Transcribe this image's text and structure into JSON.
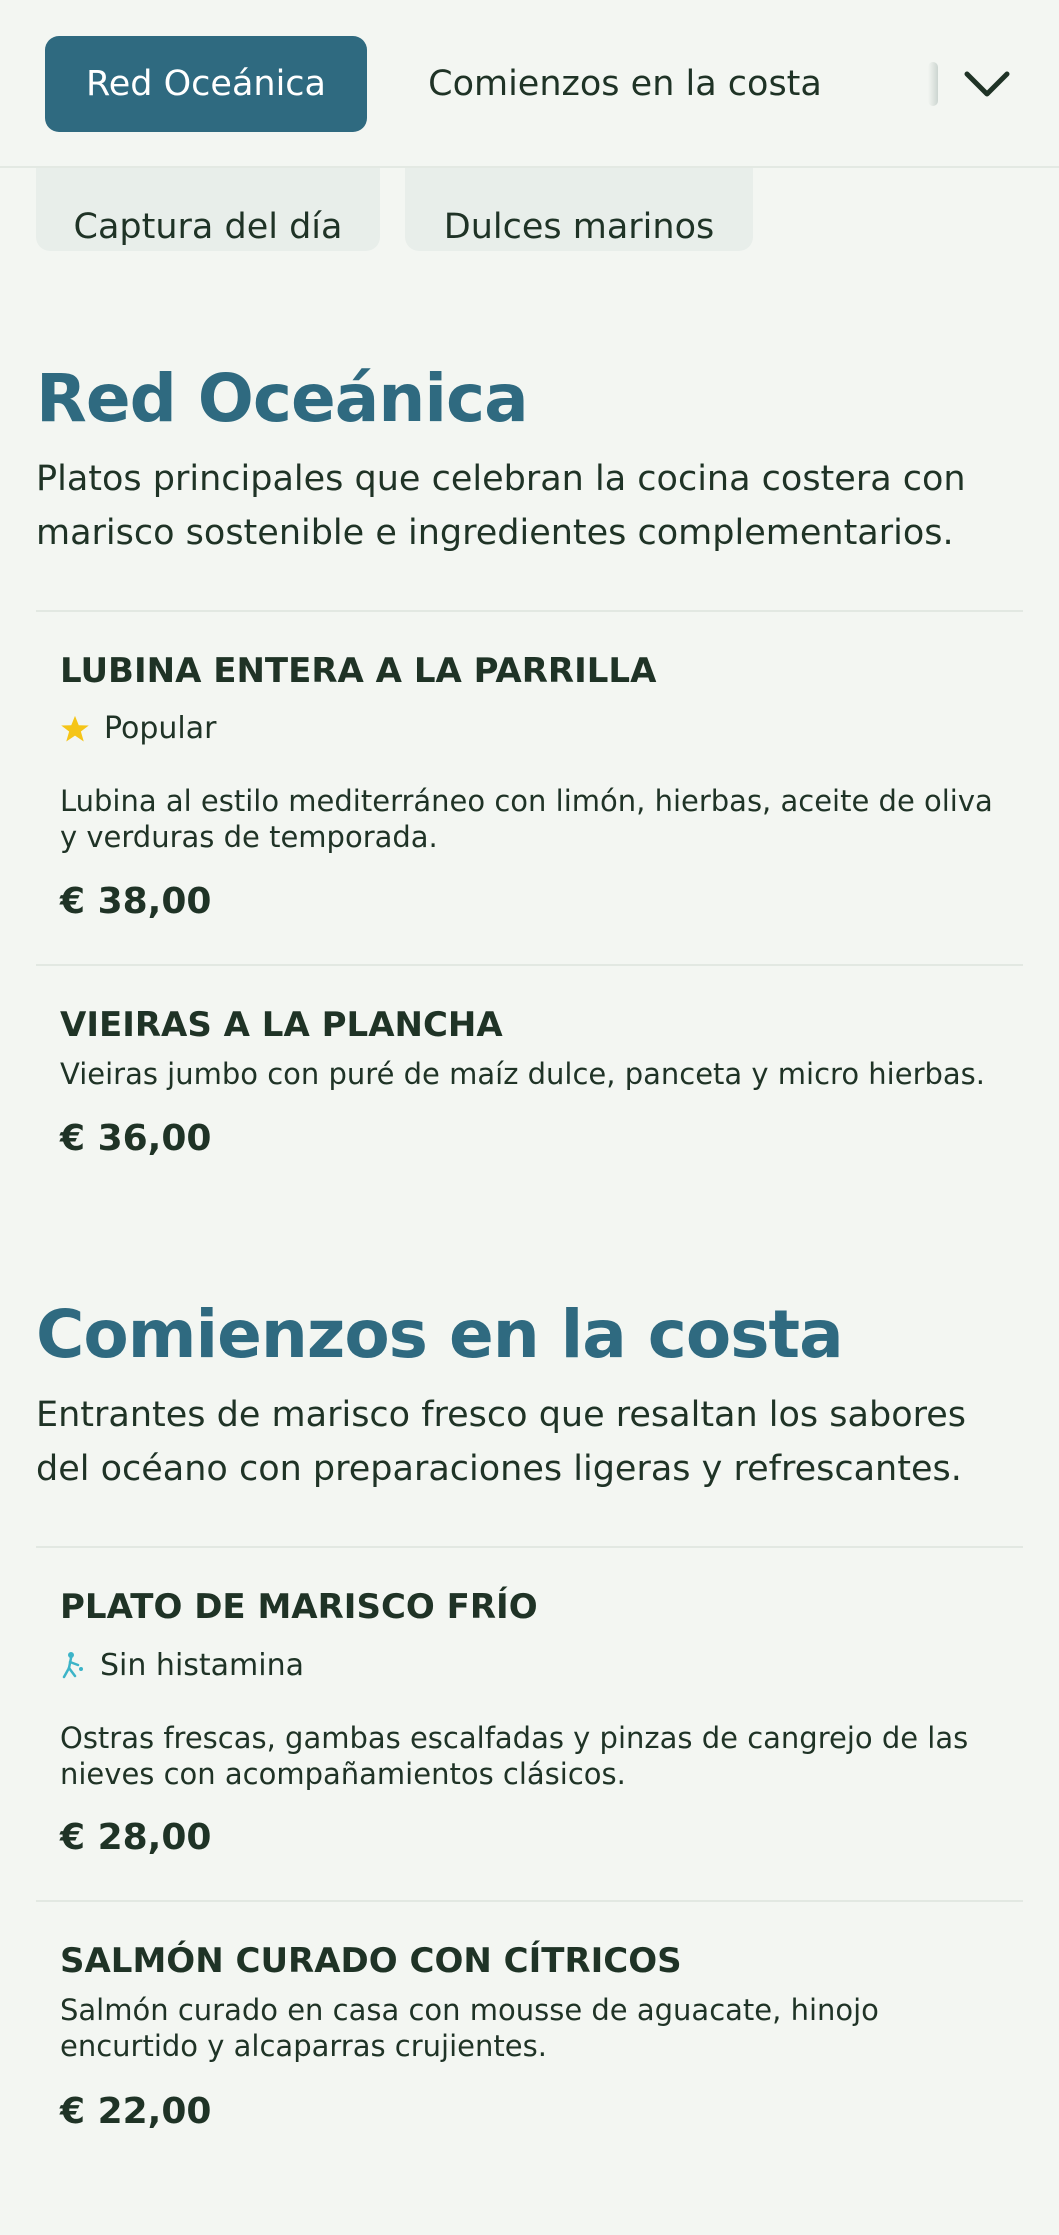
{
  "nav": {
    "active_tab": "Red Oceánica",
    "second_tab": "Comienzos en la costa",
    "more_icon": "chevron-down-icon",
    "pills": [
      "Captura del día",
      "Dulces marinos"
    ]
  },
  "colors": {
    "accent": "#2f6a80",
    "background": "#f3f6f2",
    "text": "#1f3326",
    "star": "#f5c518",
    "histamine_icon": "#3cb4c8"
  },
  "sections": [
    {
      "title": "Red Oceánica",
      "description": "Platos principales que celebran la cocina costera con marisco sostenible e ingredientes complementarios.",
      "items": [
        {
          "name": "LUBINA ENTERA A LA PARRILLA",
          "badge": {
            "icon": "star-icon",
            "label": "Popular"
          },
          "description": "Lubina al estilo mediterráneo con limón, hierbas, aceite de oliva y verduras de temporada.",
          "price": "€ 38,00"
        },
        {
          "name": "VIEIRAS A LA PLANCHA",
          "description": "Vieiras jumbo con puré de maíz dulce, panceta y micro hierbas.",
          "price": "€ 36,00"
        }
      ]
    },
    {
      "title": "Comienzos en la costa",
      "description": "Entrantes de marisco fresco que resaltan los sabores del océano con preparaciones ligeras y refrescantes.",
      "items": [
        {
          "name": "PLATO DE MARISCO FRÍO",
          "badge": {
            "icon": "histamine-free-icon",
            "label": "Sin histamina"
          },
          "description": "Ostras frescas, gambas escalfadas y pinzas de cangrejo de las nieves con acompañamientos clásicos.",
          "price": "€ 28,00"
        },
        {
          "name": "SALMÓN CURADO CON CÍTRICOS",
          "description": "Salmón curado en casa con mousse de aguacate, hinojo encurtido y alcaparras crujientes.",
          "price": "€ 22,00"
        }
      ]
    }
  ]
}
